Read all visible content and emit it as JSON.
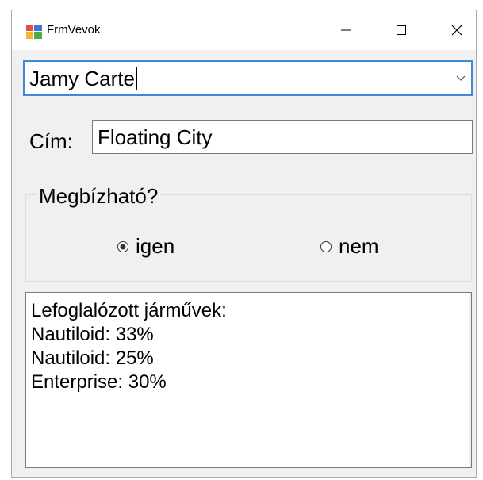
{
  "window": {
    "title": "FrmVevok",
    "controls": {
      "minimize": "minimize",
      "maximize": "maximize",
      "close": "close"
    }
  },
  "customer_combo": {
    "value": "Jamy Carte"
  },
  "address": {
    "label": "Cím:",
    "value": "Floating City"
  },
  "reliable_group": {
    "title": "Megbízható?",
    "options": [
      {
        "label": "igen",
        "checked": true
      },
      {
        "label": "nem",
        "checked": false
      }
    ]
  },
  "vehicles_box": {
    "lines": [
      "Lefoglalózott járművek:",
      "Nautiloid: 33%",
      "Nautiloid: 25%",
      "Enterprise: 30%"
    ]
  },
  "colors": {
    "focus_border": "#3c8ad8",
    "window_bg": "#f0f0f0"
  }
}
